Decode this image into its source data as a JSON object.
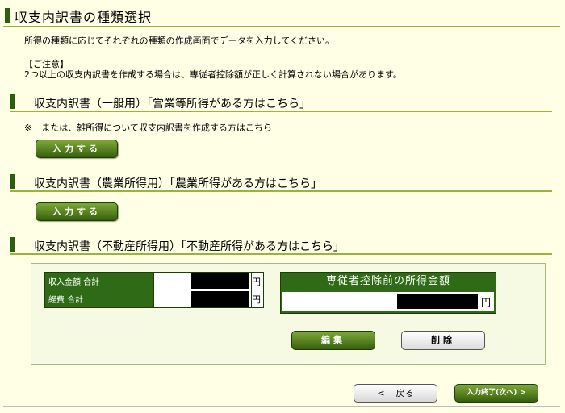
{
  "page": {
    "title": "収支内訳書の種類選択",
    "intro": "所得の種類に応じてそれぞれの種類の作成画面でデータを入力してください。",
    "note_heading": "【ご注意】",
    "note_text": "2つ以上の収支内訳書を作成する場合は、専従者控除額が正しく計算されない場合があります。"
  },
  "sections": [
    {
      "title": "収支内訳書（一般用）「営業等所得がある方はこちら」",
      "remark_mark": "※",
      "remark": "または、雑所得について収支内訳書を作成する方はこちら",
      "button": "入力する"
    },
    {
      "title": "収支内訳書（農業所得用）「農業所得がある方はこちら」",
      "button": "入力する"
    },
    {
      "title": "収支内訳書（不動産所得用）「不動産所得がある方はこちら」"
    }
  ],
  "realestate": {
    "rows": [
      {
        "label": "収入金額 合計",
        "unit": "円"
      },
      {
        "label": "経費 合計",
        "unit": "円"
      }
    ],
    "income_title": "専従者控除前の所得金額",
    "income_unit": "円",
    "edit_button": "編集",
    "delete_button": "削除"
  },
  "footer": {
    "back_arrow": "<",
    "back_label": "戻る",
    "next_label": "入力終了(次へ)",
    "next_arrow": ">"
  }
}
